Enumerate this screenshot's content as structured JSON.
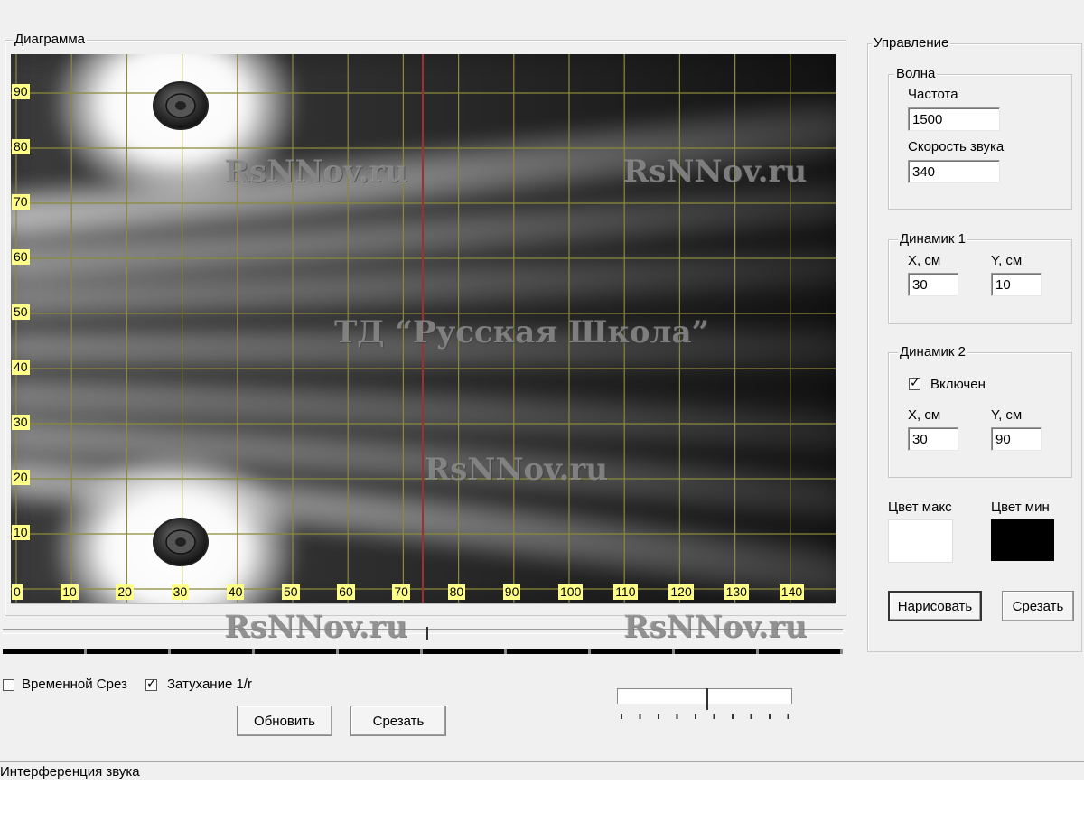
{
  "diagram": {
    "title": "Диаграмма",
    "y_ticks": [
      "90",
      "80",
      "70",
      "60",
      "50",
      "40",
      "30",
      "20",
      "10"
    ],
    "x_ticks": [
      "0",
      "10",
      "20",
      "30",
      "40",
      "50",
      "60",
      "70",
      "80",
      "90",
      "100",
      "110",
      "120",
      "130",
      "140"
    ],
    "colors": {
      "grid": "#8a8a3a",
      "cut_line": "#a03030",
      "label_bg": "#ffff88"
    }
  },
  "watermarks": {
    "site_1": "RsNNov.ru",
    "site_2": "RsNNov.ru",
    "center": "ТД “Русская Школа”",
    "site_3": "RsNNov.ru",
    "site_4": "RsNNov.ru",
    "site_5": "RsNNov.ru"
  },
  "control": {
    "title": "Управление",
    "wave": {
      "title": "Волна",
      "frequency_label": "Частота",
      "frequency_value": "1500",
      "speed_label": "Скорость звука",
      "speed_value": "340"
    },
    "speaker1": {
      "title": "Динамик 1",
      "x_label": "X, см",
      "y_label": "Y, см",
      "x_value": "30",
      "y_value": "10"
    },
    "speaker2": {
      "title": "Динамик 2",
      "enabled_label": "Включен",
      "enabled": true,
      "x_label": "X, см",
      "y_label": "Y, см",
      "x_value": "30",
      "y_value": "90"
    },
    "color_max_label": "Цвет макс",
    "color_min_label": "Цвет мин",
    "color_max": "#ffffff",
    "color_min": "#000000",
    "draw_button": "Нарисовать",
    "cut_button": "Срезать"
  },
  "bottom": {
    "time_cut_label": "Временной Срез",
    "time_cut_checked": false,
    "attenuation_label": "Затухание 1/r",
    "attenuation_checked": true,
    "refresh_button": "Обновить",
    "cut_button": "Срезать"
  },
  "status_bar": {
    "text": "Интерференция звука"
  }
}
